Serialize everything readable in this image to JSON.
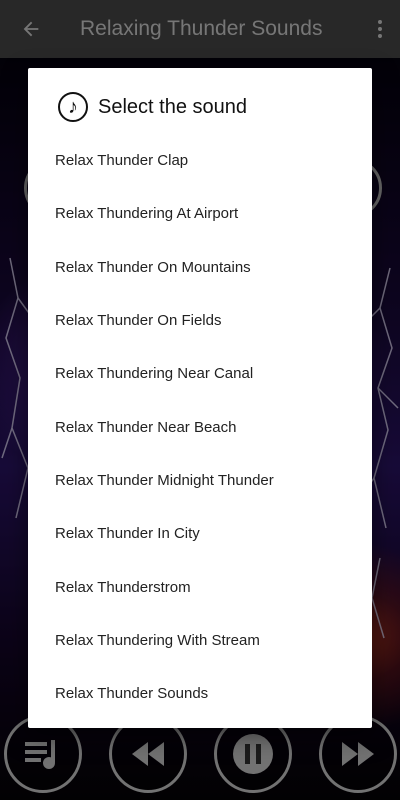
{
  "app_bar": {
    "title": "Relaxing Thunder Sounds",
    "back_icon": "arrow-back-icon",
    "menu_icon": "more-vert-icon"
  },
  "controls": {
    "playlist_icon": "playlist-icon",
    "rewind_icon": "rewind-icon",
    "pause_icon": "pause-icon",
    "forward_icon": "fast-forward-icon"
  },
  "dialog": {
    "icon": "music-note-icon",
    "title": "Select the sound",
    "items": [
      {
        "label": "Relax Thunder Clap"
      },
      {
        "label": "Relax Thundering At Airport"
      },
      {
        "label": "Relax Thunder On Mountains"
      },
      {
        "label": "Relax Thunder On Fields"
      },
      {
        "label": "Relax Thundering Near Canal"
      },
      {
        "label": "Relax Thunder Near Beach"
      },
      {
        "label": "Relax Thunder Midnight Thunder"
      },
      {
        "label": "Relax Thunder In City"
      },
      {
        "label": "Relax Thunderstrom"
      },
      {
        "label": "Relax Thundering With Stream"
      },
      {
        "label": "Relax Thunder Sounds"
      }
    ]
  },
  "colors": {
    "app_bar": "#4a4a4a",
    "dialog_bg": "#ffffff",
    "control_ring": "#cfcfcf"
  }
}
